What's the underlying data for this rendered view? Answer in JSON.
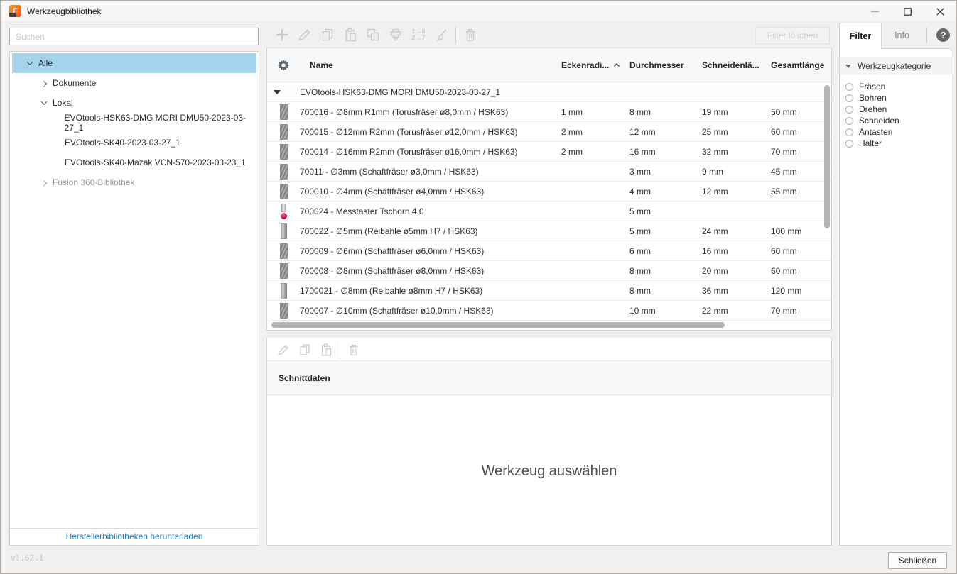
{
  "window": {
    "title": "Werkzeugbibliothek",
    "version": "v1.62.1"
  },
  "sidebar": {
    "search_placeholder": "Suchen",
    "tree": [
      {
        "label": "Alle",
        "level": 0,
        "chevron": "down",
        "selected": true
      },
      {
        "label": "Dokumente",
        "level": 1,
        "chevron": "right"
      },
      {
        "label": "Lokal",
        "level": 1,
        "chevron": "down"
      },
      {
        "label": "EVOtools-HSK63-DMG MORI DMU50-2023-03-27_1",
        "level": 2,
        "chevron": "none"
      },
      {
        "label": "EVOtools-SK40-2023-03-27_1",
        "level": 2,
        "chevron": "none"
      },
      {
        "label": "EVOtools-SK40-Mazak VCN-570-2023-03-23_1",
        "level": 2,
        "chevron": "none"
      },
      {
        "label": "Fusion 360-Bibliothek",
        "level": 1,
        "chevron": "right",
        "muted": true
      }
    ],
    "download_link": "Herstellerbibliotheken herunterladen"
  },
  "toolbar": {
    "filter_clear_label": "Filter löschen",
    "renumber_line1": "1→6",
    "renumber_line2": "2→7"
  },
  "table": {
    "columns": [
      "Name",
      "Eckenradi...",
      "Durchmesser",
      "Schneidenlä...",
      "Gesamtlänge"
    ],
    "sorted_by": "Eckenradi...",
    "sort_direction": "ascending",
    "group_row": "EVOtools-HSK63-DMG MORI DMU50-2023-03-27_1",
    "rows": [
      {
        "icon": "endmill",
        "name": "700016 - ∅8mm R1mm (Torusfräser ø8,0mm / HSK63)",
        "eckenradius": "1 mm",
        "durchmesser": "8 mm",
        "schneidenlaenge": "19 mm",
        "gesamtlaenge": "50 mm"
      },
      {
        "icon": "endmill",
        "name": "700015 - ∅12mm R2mm (Torusfräser ø12,0mm / HSK63)",
        "eckenradius": "2 mm",
        "durchmesser": "12 mm",
        "schneidenlaenge": "25 mm",
        "gesamtlaenge": "60 mm"
      },
      {
        "icon": "endmill",
        "name": "700014 - ∅16mm R2mm (Torusfräser ø16,0mm / HSK63)",
        "eckenradius": "2 mm",
        "durchmesser": "16 mm",
        "schneidenlaenge": "32 mm",
        "gesamtlaenge": "70 mm"
      },
      {
        "icon": "endmill",
        "name": "70011 - ∅3mm (Schaftfräser ø3,0mm / HSK63)",
        "eckenradius": "",
        "durchmesser": "3 mm",
        "schneidenlaenge": "9 mm",
        "gesamtlaenge": "45 mm"
      },
      {
        "icon": "endmill",
        "name": "700010 - ∅4mm (Schaftfräser ø4,0mm / HSK63)",
        "eckenradius": "",
        "durchmesser": "4 mm",
        "schneidenlaenge": "12 mm",
        "gesamtlaenge": "55 mm"
      },
      {
        "icon": "probe",
        "name": "700024 - Messtaster Tschorn 4.0",
        "eckenradius": "",
        "durchmesser": "5 mm",
        "schneidenlaenge": "",
        "gesamtlaenge": ""
      },
      {
        "icon": "reamer",
        "name": "700022 - ∅5mm (Reibahle ø5mm H7 / HSK63)",
        "eckenradius": "",
        "durchmesser": "5 mm",
        "schneidenlaenge": "24 mm",
        "gesamtlaenge": "100 mm"
      },
      {
        "icon": "endmill",
        "name": "700009 - ∅6mm (Schaftfräser ø6,0mm / HSK63)",
        "eckenradius": "",
        "durchmesser": "6 mm",
        "schneidenlaenge": "16 mm",
        "gesamtlaenge": "60 mm"
      },
      {
        "icon": "endmill",
        "name": "700008 - ∅8mm (Schaftfräser ø8,0mm / HSK63)",
        "eckenradius": "",
        "durchmesser": "8 mm",
        "schneidenlaenge": "20 mm",
        "gesamtlaenge": "60 mm"
      },
      {
        "icon": "reamer",
        "name": "1700021 - ∅8mm (Reibahle ø8mm H7 / HSK63)",
        "eckenradius": "",
        "durchmesser": "8 mm",
        "schneidenlaenge": "36 mm",
        "gesamtlaenge": "120 mm"
      },
      {
        "icon": "endmill",
        "name": "700007 - ∅10mm (Schaftfräser ø10,0mm / HSK63)",
        "eckenradius": "",
        "durchmesser": "10 mm",
        "schneidenlaenge": "22 mm",
        "gesamtlaenge": "70 mm"
      }
    ]
  },
  "details": {
    "section_label": "Schnittdaten",
    "empty_message": "Werkzeug auswählen"
  },
  "filter_panel": {
    "tab_filter": "Filter",
    "tab_info": "Info",
    "help_glyph": "?",
    "section_title": "Werkzeugkategorie",
    "categories": [
      "Fräsen",
      "Bohren",
      "Drehen",
      "Schneiden",
      "Antasten",
      "Halter"
    ]
  },
  "footer": {
    "close_label": "Schließen"
  },
  "colors": {
    "selection_blue": "#a5d3ec",
    "link_blue": "#1f7ab5",
    "probe_red": "#b60e36",
    "fusion_orange": "#ef6d2a"
  }
}
